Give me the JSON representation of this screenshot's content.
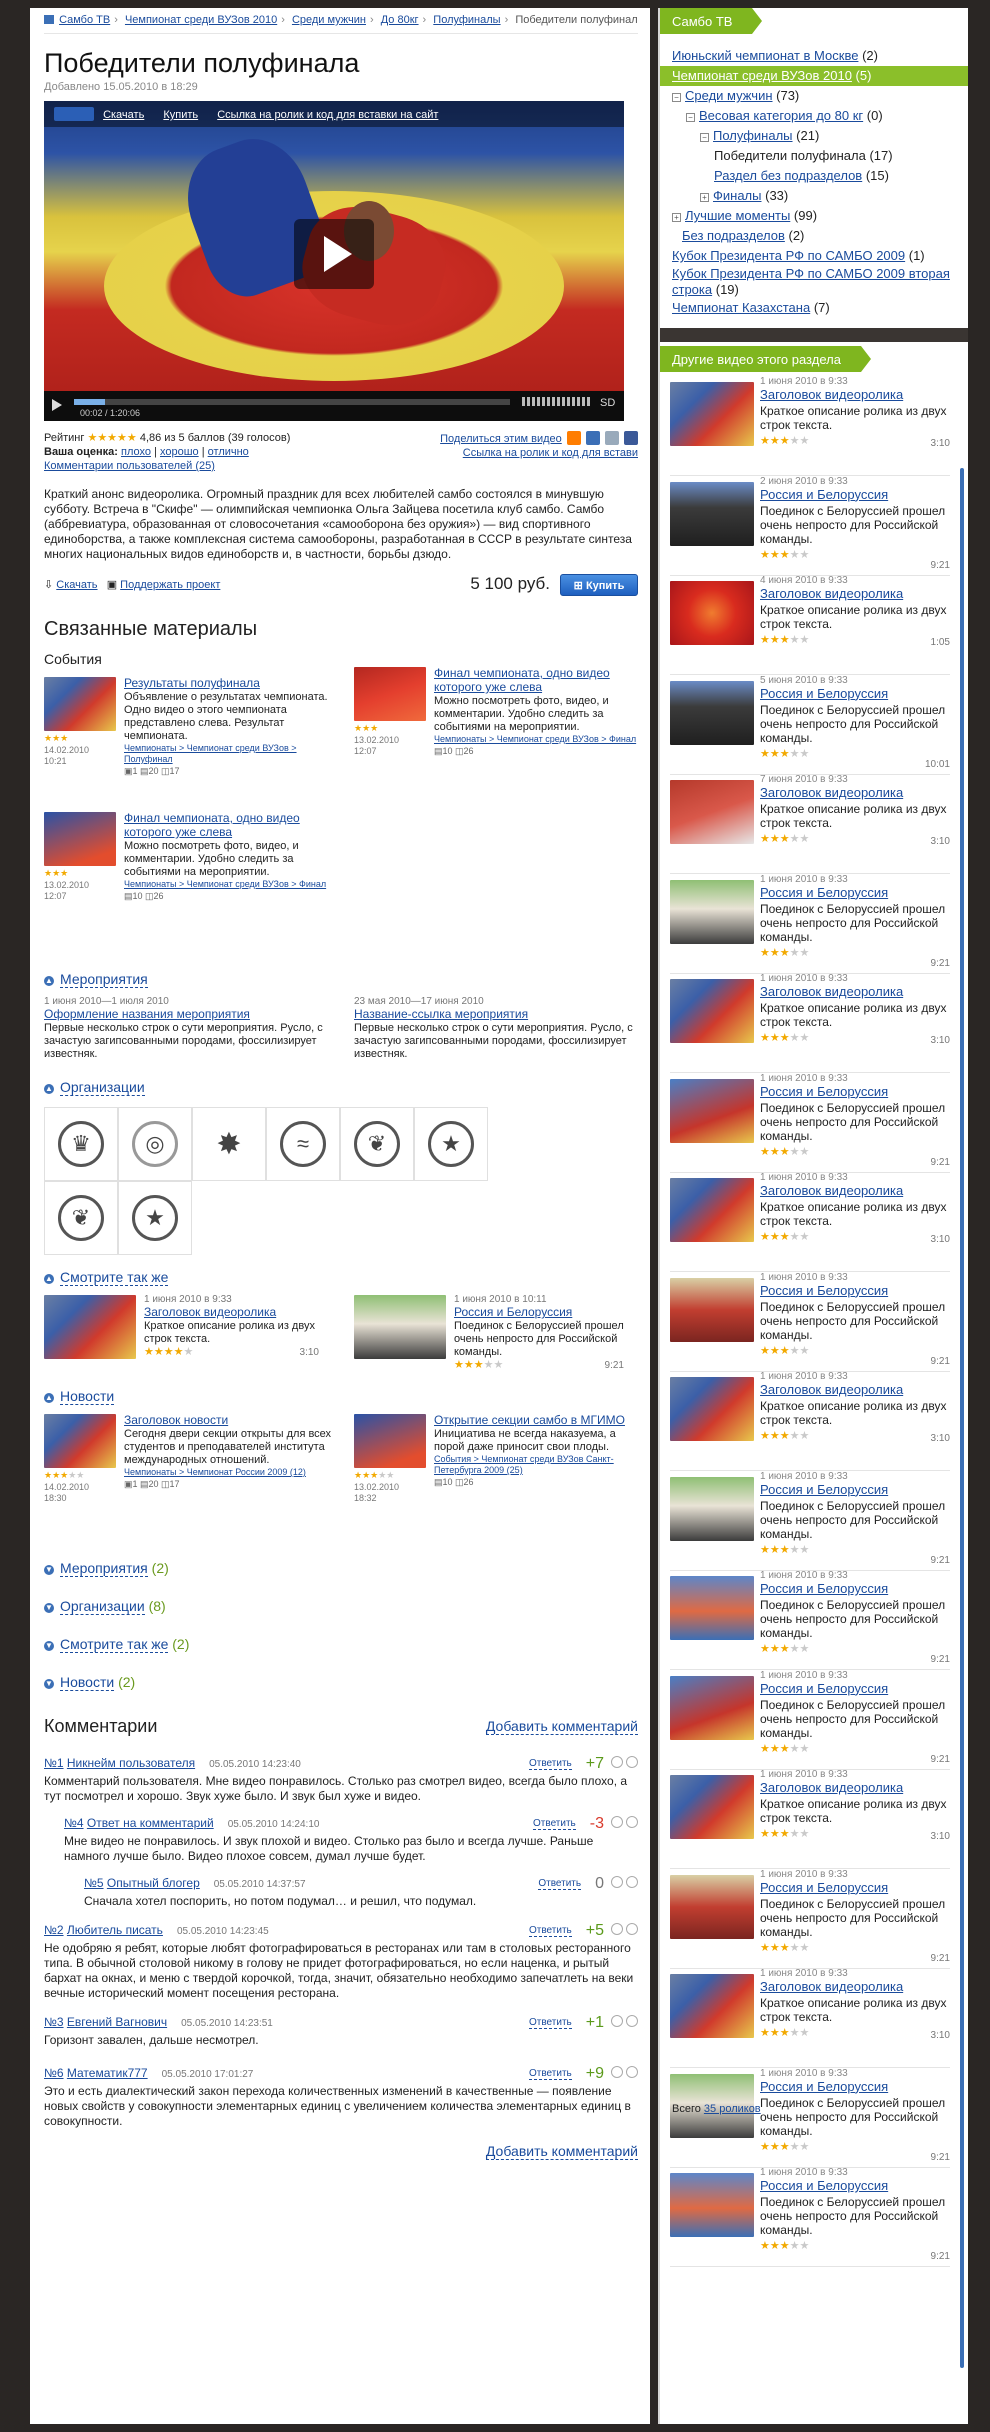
{
  "breadcrumbs": [
    "Самбо ТВ",
    "Чемпионат среди ВУЗов 2010",
    "Среди мужчин",
    "До 80кг",
    "Полуфиналы",
    "Победители полуфинала"
  ],
  "title": "Победители полуфинала",
  "added": "Добавлено 15.05.2010 в 18:29",
  "player": {
    "download": "Скачать",
    "buy": "Купить",
    "embed": "Ссылка на ролик и код для вставки на сайт",
    "time": "00:02  /  1:20:06",
    "quality": "SD",
    "progress": 0.07
  },
  "rating": {
    "label": "Рейтинг",
    "stars": "★★★★★",
    "value": "4,86 из 5 баллов (39 голосов)",
    "your": "Ваша оценка:",
    "opts": [
      "плохо",
      "хорошо",
      "отлично"
    ],
    "comments": "Комментарии пользователей (25)",
    "share": "Поделиться этим видео",
    "embed": "Ссылка на ролик и код для встави"
  },
  "description": "Краткий анонс видеоролика. Огромный праздник для всех любителей самбо состоялся в минувшую субботу. Встреча в \"Скифе\" — олимпийская чемпионка Ольга Зайцева посетила клуб самбо. Самбо (аббревиатура, образованная от словосочетания «самооборона без оружия») — вид спортивного единоборства, а также комплексная система самообороны, разработанная в СССР в результате синтеза многих национальных видов единоборств и, в частности, борьбы дзюдо.",
  "buy": {
    "download": "Скачать",
    "support": "Поддержать проект",
    "price": "5 100 руб.",
    "button": "Купить"
  },
  "related": {
    "title": "Связанные материалы",
    "events_title": "События",
    "events": [
      {
        "title": "Результаты полуфинала",
        "text": "Объявление о результатах чемпионата. Одно видео о этого чемпионата представлено слева. Результат чемпионата.",
        "date": "14.02.2010",
        "time": "10:21",
        "stars": "★★★",
        "links": "Чемпионаты > Чемпионат среди ВУЗов > Полуфинал",
        "icons": "▣1  ▤20  ◫17"
      },
      {
        "title": "Финал чемпионата, одно видео которого уже слева",
        "text": "Можно посмотреть фото, видео, и комментарии. Удобно следить за событиями на мероприятии.",
        "date": "13.02.2010",
        "time": "12:07",
        "stars": "★★★",
        "links": "Чемпионаты > Чемпионат среди ВУЗов > Финал",
        "icons": "▤10  ◫26"
      },
      {
        "title": "Финал чемпионата, одно видео которого уже слева",
        "text": "Можно посмотреть фото, видео, и комментарии. Удобно следить за событиями на мероприятии.",
        "date": "13.02.2010",
        "time": "12:07",
        "stars": "★★★",
        "links": "Чемпионаты > Чемпионат среди ВУЗов > Финал",
        "icons": "▤10  ◫26"
      }
    ]
  },
  "meropr": {
    "title": "Мероприятия",
    "items": [
      {
        "dates": "1 июня 2010—1 июля 2010",
        "title": "Оформление названия мероприятия",
        "text": "Первые несколько строк о сути мероприятия. Русло, с зачастую загипсованными породами, фоссилизирует известняк."
      },
      {
        "dates": "23 мая 2010—17 июня 2010",
        "title": "Название-ссылка мероприятия",
        "text": "Первые несколько строк о сути мероприятия. Русло, с зачастую загипсованными породами, фоссилизирует известняк."
      }
    ]
  },
  "orgs": {
    "title": "Организации",
    "count": 8
  },
  "see_also": {
    "title": "Смотрите так же",
    "items": [
      {
        "date": "1 июня 2010 в 9:33",
        "title": "Заголовок видеоролика",
        "text": "Краткое описание ролика из двух строк текста.",
        "duration": "3:10"
      },
      {
        "date": "1 июня 2010 в 10:11",
        "title": "Россия и Белоруссия",
        "text": "Поединок с Белоруссией прошел очень непросто для Российской команды.",
        "duration": "9:21"
      }
    ]
  },
  "news": {
    "title": "Новости",
    "items": [
      {
        "title": "Заголовок новости",
        "text": "Сегодня двери секции открыты для всех студентов и преподавателей института международных отношений.",
        "date": "14.02.2010",
        "time": "18:30",
        "links": "Чемпионаты > Чемпионат России 2009 (12)",
        "icons": "▣1  ▤20  ◫17"
      },
      {
        "title": "Открытие секции самбо в МГИМО",
        "text": "Инициатива не всегда наказуема, а порой даже приносит свои плоды.",
        "date": "13.02.2010",
        "time": "18:32",
        "links": "События > Чемпионат среди ВУЗов Санкт-Петербурга 2009 (25)",
        "icons": "▤10  ◫26"
      }
    ]
  },
  "collapsed": [
    {
      "label": "Мероприятия",
      "count": "(2)"
    },
    {
      "label": "Организации",
      "count": "(8)"
    },
    {
      "label": "Смотрите так же",
      "count": "(2)"
    },
    {
      "label": "Новости",
      "count": "(2)"
    }
  ],
  "comments": {
    "title": "Комментарии",
    "add": "Добавить комментарий",
    "reply": "Ответить",
    "items": [
      {
        "num": "№1",
        "name": "Никнейм пользователя",
        "date": "05.05.2010 14:23:40",
        "score": "+7",
        "cls": "pos",
        "text": "Комментарий пользователя. Мне видео понравилось. Столько раз смотрел видео, всегда было плохо, а тут посмотрел и хорошо. Звук хуже было. И звук был хуже и видео.",
        "indent": 0
      },
      {
        "num": "№4",
        "name": "Ответ на комментарий",
        "date": "05.05.2010 14:24:10",
        "score": "-3",
        "cls": "neg",
        "text": "Мне видео не понравилось. И звук плохой и видео. Столько раз было и всегда лучше. Раньше намного лучше было. Видео плохое совсем, думал лучше будет.",
        "indent": 1
      },
      {
        "num": "№5",
        "name": "Опытный блогер",
        "date": "05.05.2010 14:37:57",
        "score": "0",
        "cls": "zero",
        "text": "Сначала хотел поспорить, но потом подумал… и решил, что подумал.",
        "indent": 2
      },
      {
        "num": "№2",
        "name": "Любитель писать",
        "date": "05.05.2010 14:23:45",
        "score": "+5",
        "cls": "pos",
        "text": "Не одобряю я ребят, которые любят фотографироваться в ресторанах или там в столовых ресторанного типа. В обычной столовой никому в голову не придет фотографироваться, но если наценка, и рытый бархат на окнах, и меню с твердой корочкой, тогда, значит, обязательно необходимо запечатлеть на веки вечные исторический момент посещения ресторана.",
        "indent": 0
      },
      {
        "num": "№3",
        "name": "Евгений Вагнович",
        "date": "05.05.2010 14:23:51",
        "score": "+1",
        "cls": "pos",
        "text": "Горизонт завален, дальше несмотрел.",
        "indent": 0
      },
      {
        "num": "№6",
        "name": "Математик777",
        "date": "05.05.2010 17:01:27",
        "score": "+9",
        "cls": "pos",
        "text": "Это и есть диалектический закон перехода количественных изменений в качественные — появление новых свойств у совокупности элементарных единиц с увеличением количества элементарных единиц в совокупности.",
        "indent": 0
      }
    ]
  },
  "sidebar": {
    "tab": "Самбо ТВ",
    "tree": [
      {
        "label": "Июньский чемпионат в Москве",
        "count": "(2)",
        "lvl": 0,
        "pm": "",
        "hl": false
      },
      {
        "label": "Чемпионат среди ВУЗов 2010",
        "count": "(5)",
        "lvl": 0,
        "pm": "",
        "hl": true
      },
      {
        "label": "Среди мужчин",
        "count": "(73)",
        "lvl": 0,
        "pm": "−",
        "hl": false
      },
      {
        "label": "Весовая категория до 80 кг",
        "count": "(0)",
        "lvl": 1,
        "pm": "−",
        "hl": false
      },
      {
        "label": "Полуфиналы",
        "count": "(21)",
        "lvl": 2,
        "pm": "−",
        "hl": false
      },
      {
        "label": "Победители полуфинала",
        "count": "(17)",
        "lvl": 3,
        "pm": "",
        "hl": false,
        "plain": true
      },
      {
        "label": "Раздел без подразделов",
        "count": "(15)",
        "lvl": 3,
        "pm": "",
        "hl": false
      },
      {
        "label": "Финалы",
        "count": "(33)",
        "lvl": 2,
        "pm": "+",
        "hl": false
      },
      {
        "label": "Лучшие моменты",
        "count": "(99)",
        "lvl": 0,
        "pm": "+",
        "hl": false
      },
      {
        "label": "Без подразделов",
        "count": "(2)",
        "lvl": 0,
        "pm": "",
        "hl": false,
        "ind": true
      },
      {
        "label": "Кубок Президента РФ по САМБО 2009",
        "count": "(1)",
        "lvl": 0,
        "pm": "",
        "hl": false
      },
      {
        "label": "Кубок Президента РФ по САМБО 2009 вторая строка",
        "count": "(19)",
        "lvl": 0,
        "pm": "",
        "hl": false,
        "wrap": true
      },
      {
        "label": "Чемпионат Казахстана",
        "count": "(7)",
        "lvl": 0,
        "pm": "",
        "hl": false
      }
    ],
    "other_tab": "Другие видео этого раздела",
    "videos": [
      {
        "date": "1 июня 2010 в 9:33",
        "title": "Заголовок видеоролика",
        "text": "Краткое описание ролика из двух строк текста.",
        "dur": "3:10",
        "thumb": "t-samb"
      },
      {
        "date": "2 июня 2010 в 9:33",
        "title": "Россия и Белоруссия",
        "text": "Поединок с Белоруссией прошел очень непросто для Российской команды.",
        "dur": "9:21",
        "thumb": "t-crowd"
      },
      {
        "date": "4 июня 2010 в 9:33",
        "title": "Заголовок видеоролика",
        "text": "Краткое описание ролика из двух строк текста.",
        "dur": "1:05",
        "thumb": "t-mascot"
      },
      {
        "date": "5 июня 2010 в 9:33",
        "title": "Россия и Белоруссия",
        "text": "Поединок с Белоруссией прошел очень непросто для Российской команды.",
        "dur": "10:01",
        "thumb": "t-crowd"
      },
      {
        "date": "7 июня 2010 в 9:33",
        "title": "Заголовок видеоролика",
        "text": "Краткое описание ролика из двух строк текста.",
        "dur": "3:10",
        "thumb": "t-track"
      },
      {
        "date": "1 июня 2010 в 9:33",
        "title": "Россия и Белоруссия",
        "text": "Поединок с Белоруссией прошел очень непросто для Российской команды.",
        "dur": "9:21",
        "thumb": "t-woman"
      },
      {
        "date": "1 июня 2010 в 9:33",
        "title": "Заголовок видеоролика",
        "text": "Краткое описание ролика из двух строк текста.",
        "dur": "3:10",
        "thumb": "t-samb"
      },
      {
        "date": "1 июня 2010 в 9:33",
        "title": "Россия и Белоруссия",
        "text": "Поединок с Белоруссией прошел очень непросто для Российской команды.",
        "dur": "9:21",
        "thumb": "t-mix"
      },
      {
        "date": "1 июня 2010 в 9:33",
        "title": "Заголовок видеоролика",
        "text": "Краткое описание ролика из двух строк текста.",
        "dur": "3:10",
        "thumb": "t-samb"
      },
      {
        "date": "1 июня 2010 в 9:33",
        "title": "Россия и Белоруссия",
        "text": "Поединок с Белоруссией прошел очень непросто для Российской команды.",
        "dur": "9:21",
        "thumb": "t-hall"
      },
      {
        "date": "1 июня 2010 в 9:33",
        "title": "Заголовок видеоролика",
        "text": "Краткое описание ролика из двух строк текста.",
        "dur": "3:10",
        "thumb": "t-samb"
      },
      {
        "date": "1 июня 2010 в 9:33",
        "title": "Россия и Белоруссия",
        "text": "Поединок с Белоруссией прошел очень непросто для Российской команды.",
        "dur": "9:21",
        "thumb": "t-woman"
      },
      {
        "date": "1 июня 2010 в 9:33",
        "title": "Россия и Белоруссия",
        "text": "Поединок с Белоруссией прошел очень непросто для Российской команды.",
        "dur": "9:21",
        "thumb": "t-court"
      },
      {
        "date": "1 июня 2010 в 9:33",
        "title": "Россия и Белоруссия",
        "text": "Поединок с Белоруссией прошел очень непросто для Российской команды.",
        "dur": "9:21",
        "thumb": "t-mix"
      },
      {
        "date": "1 июня 2010 в 9:33",
        "title": "Заголовок видеоролика",
        "text": "Краткое описание ролика из двух строк текста.",
        "dur": "3:10",
        "thumb": "t-samb"
      },
      {
        "date": "1 июня 2010 в 9:33",
        "title": "Россия и Белоруссия",
        "text": "Поединок с Белоруссией прошел очень непросто для Российской команды.",
        "dur": "9:21",
        "thumb": "t-hall"
      },
      {
        "date": "1 июня 2010 в 9:33",
        "title": "Заголовок видеоролика",
        "text": "Краткое описание ролика из двух строк текста.",
        "dur": "3:10",
        "thumb": "t-samb"
      },
      {
        "date": "1 июня 2010 в 9:33",
        "title": "Россия и Белоруссия",
        "text": "Поединок с Белоруссией прошел очень непросто для Российской команды.",
        "dur": "9:21",
        "thumb": "t-woman"
      },
      {
        "date": "1 июня 2010 в 9:33",
        "title": "Россия и Белоруссия",
        "text": "Поединок с Белоруссией прошел очень непросто для Российской команды.",
        "dur": "9:21",
        "thumb": "t-court"
      }
    ],
    "total_prefix": "Всего ",
    "total_link": "35 роликов"
  }
}
